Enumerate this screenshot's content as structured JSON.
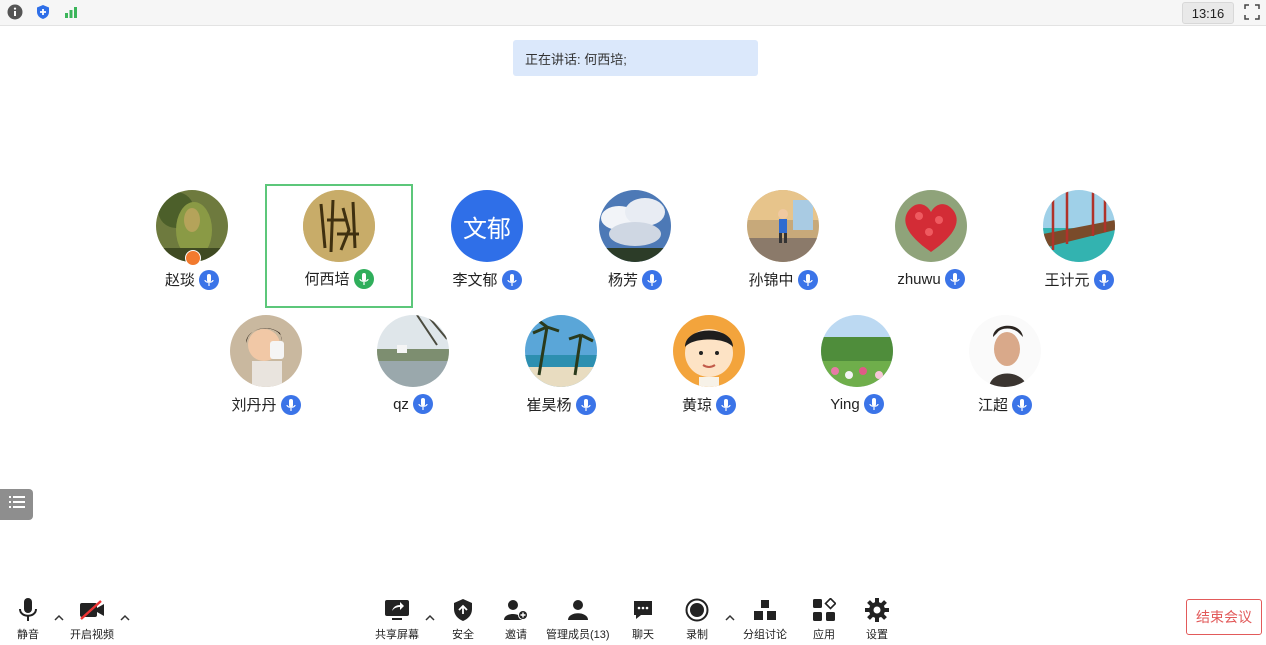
{
  "topbar": {
    "icons": [
      "info-icon",
      "shield-icon",
      "signal-icon"
    ],
    "time": "13:16",
    "fullscreen_icon": "fullscreen-icon"
  },
  "speaking": "正在讲话: 何西培;",
  "participants": [
    {
      "name": "赵琰",
      "avatar": "photo-plant",
      "mic": "on",
      "host": true
    },
    {
      "name": "何西培",
      "avatar": "photo-calligraphy",
      "mic": "speaking",
      "active": true
    },
    {
      "name": "李文郁",
      "avatar": "initials",
      "avatar_text": "文郁",
      "avatar_color": "#2f6fe8",
      "mic": "on"
    },
    {
      "name": "杨芳",
      "avatar": "photo-clouds",
      "mic": "on"
    },
    {
      "name": "孙锦中",
      "avatar": "photo-child-skating",
      "mic": "on"
    },
    {
      "name": "zhuwu",
      "avatar": "photo-heart-balloons",
      "mic": "on"
    },
    {
      "name": "王计元",
      "avatar": "photo-bridge",
      "mic": "on"
    },
    {
      "name": "刘丹丹",
      "avatar": "photo-girl",
      "mic": "on"
    },
    {
      "name": "qz",
      "avatar": "photo-lake",
      "mic": "on"
    },
    {
      "name": "崔昊杨",
      "avatar": "photo-beach",
      "mic": "on"
    },
    {
      "name": "黄琼",
      "avatar": "cartoon-face",
      "mic": "on"
    },
    {
      "name": "Ying",
      "avatar": "photo-garden",
      "mic": "on"
    },
    {
      "name": "江超",
      "avatar": "photo-man",
      "mic": "on"
    }
  ],
  "toolbar": {
    "mute": "静音",
    "video": "开启视频",
    "share": "共享屏幕",
    "security": "安全",
    "invite": "邀请",
    "members": "管理成员(13)",
    "chat": "聊天",
    "record": "录制",
    "breakout": "分组讨论",
    "apps": "应用",
    "settings": "设置",
    "end": "结束会议"
  },
  "colors": {
    "mic_blue": "#3b74e8",
    "mic_green": "#2fae5b",
    "active_border": "#5cc77a",
    "speaking_bg": "#dbe8fb",
    "end_red": "#e25a5a"
  }
}
